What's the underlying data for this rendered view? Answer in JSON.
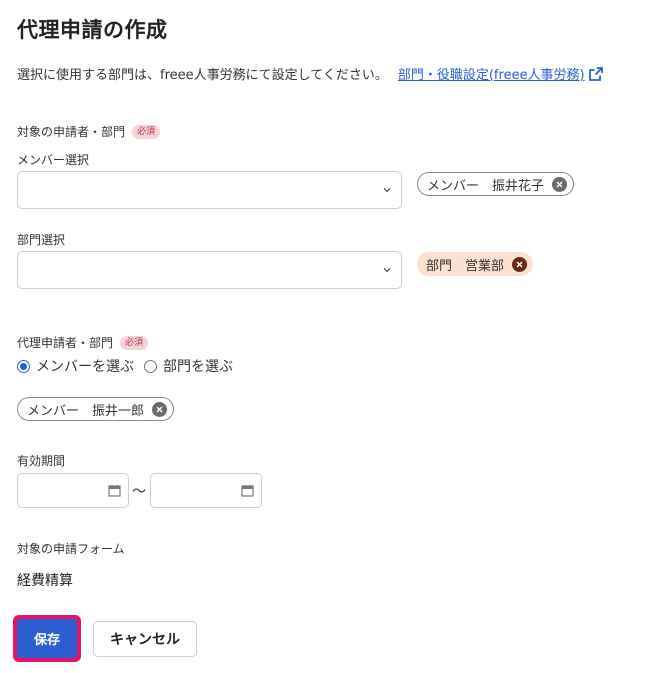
{
  "page": {
    "title": "代理申請の作成",
    "intro_text": "選択に使用する部門は、freee人事労務にて設定してください。",
    "intro_link": "部門・役職設定(freee人事労務)"
  },
  "target_section": {
    "label": "対象の申請者・部門",
    "required_badge": "必須",
    "member_select_label": "メンバー選択",
    "member_chip": "メンバー　振井花子",
    "department_select_label": "部門選択",
    "department_chip": "部門　営業部"
  },
  "proxy_section": {
    "label": "代理申請者・部門",
    "required_badge": "必須",
    "radio_member": "メンバーを選ぶ",
    "radio_department": "部門を選ぶ",
    "selected_radio": "member",
    "member_chip": "メンバー　振井一郎"
  },
  "validity": {
    "label": "有効期間",
    "start_value": "",
    "end_value": "",
    "separator": "〜"
  },
  "form_section": {
    "label": "対象の申請フォーム",
    "value": "経費精算"
  },
  "actions": {
    "save_label": "保存",
    "cancel_label": "キャンセル"
  },
  "icons": {
    "external_link": "external-link-icon",
    "chevron": "chevron-down-icon",
    "close": "close-icon",
    "calendar": "calendar-icon"
  },
  "colors": {
    "link": "#2b5fd9",
    "primary_button": "#2d5fd1",
    "highlight_border": "#e5126b",
    "required_badge_bg": "#f6d3d8",
    "department_chip_bg": "#fbe1d2"
  }
}
